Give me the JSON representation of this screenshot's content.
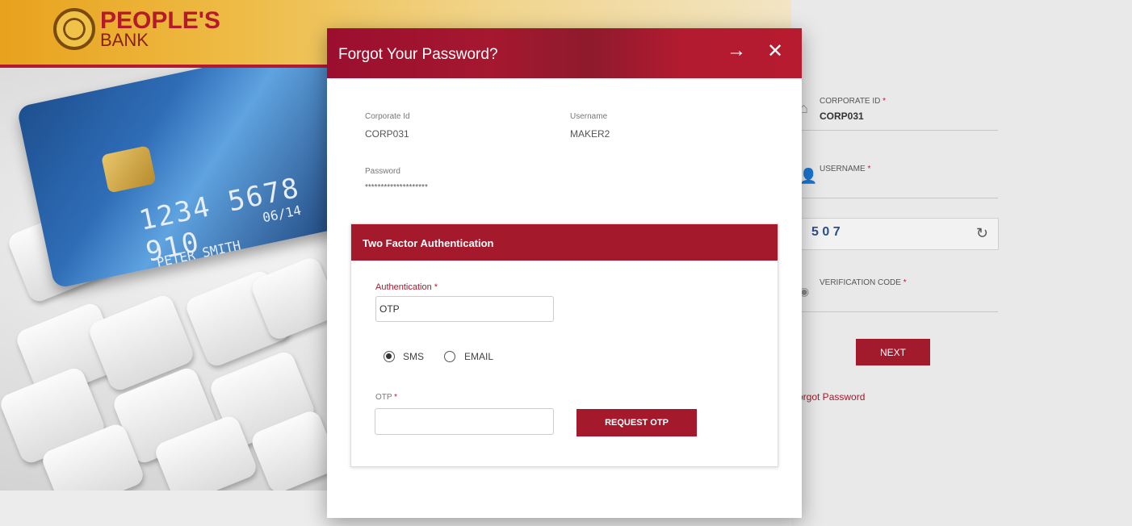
{
  "brand": {
    "name_line1": "PEOPLE'S",
    "name_line2": "BANK"
  },
  "card": {
    "number": "1234 5678 910",
    "expiry": "06/14",
    "holder": "PETER SMITH"
  },
  "login_form": {
    "corporate_id_label": "CORPORATE ID",
    "corporate_id_value": "CORP031",
    "username_label": "USERNAME",
    "captcha_text": "5 0 7",
    "verification_label": "VERIFICATION CODE",
    "next_label": "NEXT",
    "forgot_link": "orgot Password",
    "required_mark": "*"
  },
  "modal": {
    "title": "Forgot Your Password?",
    "corporate_id_label": "Corporate Id",
    "corporate_id_value": "CORP031",
    "username_label": "Username",
    "username_value": "MAKER2",
    "password_label": "Password",
    "password_value": "********************",
    "tfa": {
      "title": "Two Factor Authentication",
      "auth_label": "Authentication",
      "auth_value": "OTP",
      "radio_sms": "SMS",
      "radio_email": "EMAIL",
      "selected": "SMS",
      "otp_label": "OTP",
      "otp_value": "",
      "request_otp": "REQUEST OTP"
    }
  },
  "colors": {
    "primary": "#a41a2c",
    "header_gold": "#e8a21d"
  }
}
